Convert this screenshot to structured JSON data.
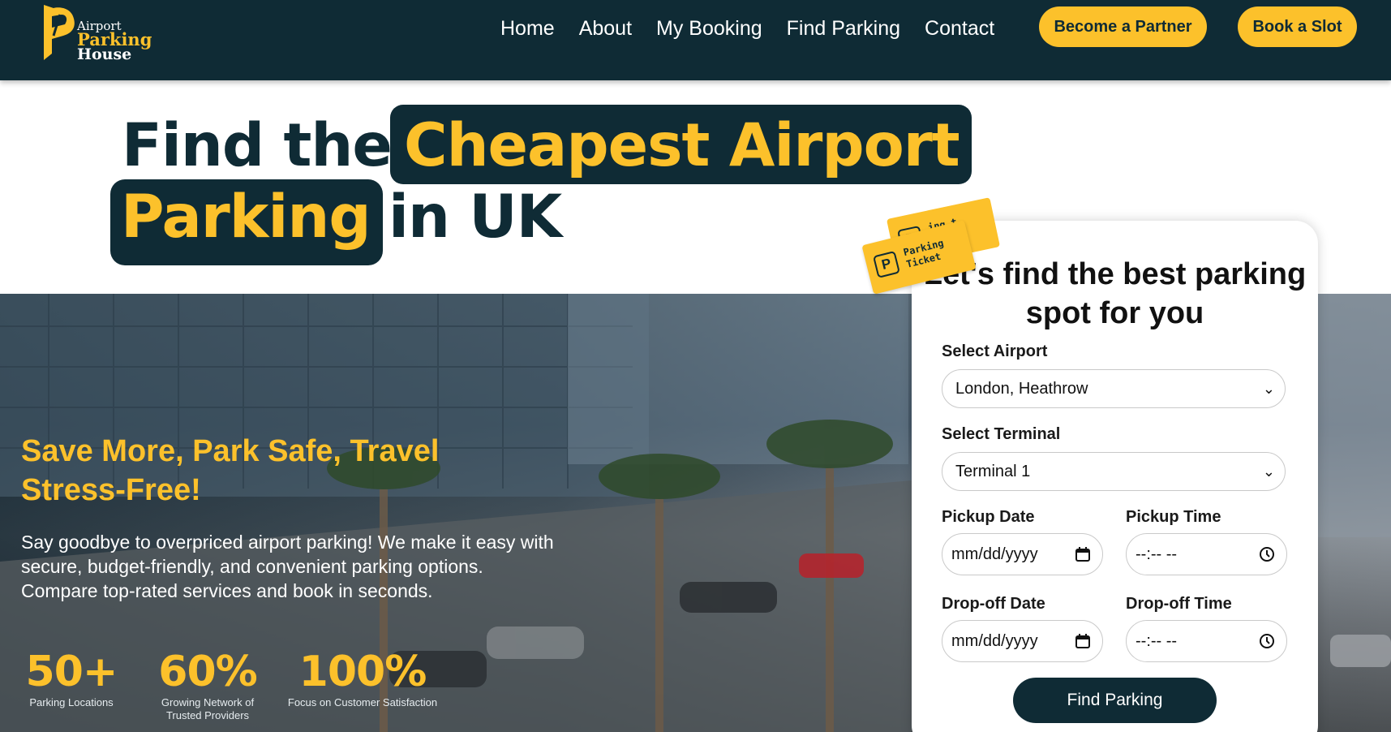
{
  "brand": {
    "line1": "Airport",
    "line2": "Parking",
    "line3": "House"
  },
  "nav": {
    "links": [
      "Home",
      "About",
      "My Booking",
      "Find Parking",
      "Contact"
    ],
    "partner_button": "Become a Partner",
    "book_button": "Book a Slot"
  },
  "headline": {
    "part1": "Find the",
    "part2": "Cheapest Airport",
    "part3": "Parking",
    "part4": "in UK"
  },
  "hero": {
    "tagline": "Save More, Park Safe, Travel Stress-Free!",
    "description": "Say goodbye to overpriced airport parking! We make it easy with secure, budget-friendly, and convenient parking options. Compare top-rated services and book in seconds.",
    "stats": [
      {
        "value": "50+",
        "label": "Parking Locations"
      },
      {
        "value": "60%",
        "label": "Growing Network of Trusted Providers"
      },
      {
        "value": "100%",
        "label": "Focus on Customer Satisfaction"
      }
    ]
  },
  "ticket": {
    "text_line1": "Parking",
    "text_line2": "Ticket",
    "back_text": "ing t"
  },
  "search": {
    "title": "Let's find the best parking spot for you",
    "airport_label": "Select Airport",
    "airport_value": "London, Heathrow",
    "terminal_label": "Select Terminal",
    "terminal_value": "Terminal 1",
    "pickup_date_label": "Pickup Date",
    "pickup_date_value": "mm/dd/yyyy",
    "pickup_time_label": "Pickup Time",
    "pickup_time_value": "--:-- --",
    "dropoff_date_label": "Drop-off Date",
    "dropoff_date_value": "mm/dd/yyyy",
    "dropoff_time_label": "Drop-off Time",
    "dropoff_time_value": "--:-- --",
    "submit_label": "Find Parking"
  },
  "colors": {
    "brand_dark": "#0f2b35",
    "brand_yellow": "#fcc12b"
  },
  "icons": [
    "logo-p-icon",
    "chevron-down-icon",
    "calendar-icon",
    "clock-icon",
    "parking-p-icon"
  ]
}
